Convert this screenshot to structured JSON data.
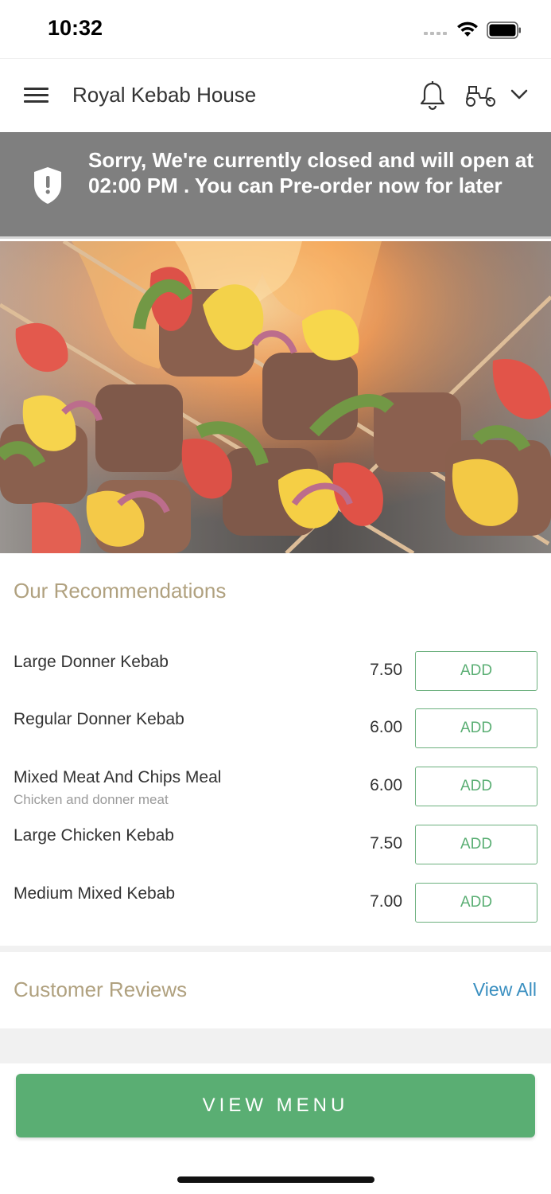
{
  "status_bar": {
    "time": "10:32"
  },
  "header": {
    "title": "Royal Kebab House"
  },
  "banner": {
    "message": "Sorry, We're currently closed and will open at 02:00 PM . You can Pre-order now for later"
  },
  "recommendations": {
    "title": "Our Recommendations",
    "add_label": "ADD",
    "items": [
      {
        "name": "Large Donner Kebab",
        "description": "",
        "price": "7.50"
      },
      {
        "name": "Regular Donner Kebab",
        "description": "",
        "price": "6.00"
      },
      {
        "name": "Mixed Meat And Chips Meal",
        "description": "Chicken and donner meat",
        "price": "6.00"
      },
      {
        "name": "Large Chicken Kebab",
        "description": "",
        "price": "7.50"
      },
      {
        "name": "Medium Mixed Kebab",
        "description": "",
        "price": "7.00"
      }
    ]
  },
  "reviews": {
    "title": "Customer Reviews",
    "view_all": "View All"
  },
  "footer": {
    "view_menu": "VIEW MENU"
  },
  "colors": {
    "accent_green": "#5aae73",
    "section_title": "#b0a17f",
    "link_blue": "#3a8fc0",
    "banner_bg": "#7f7f7f"
  }
}
